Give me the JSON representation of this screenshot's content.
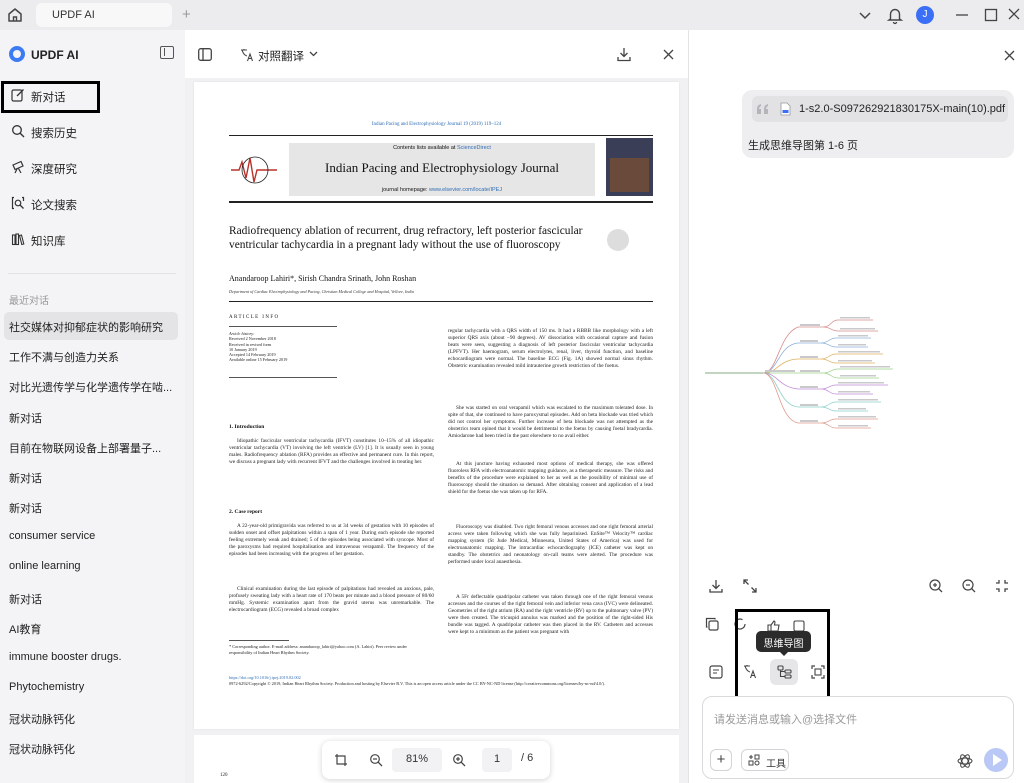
{
  "titlebar": {
    "tab_label": "UPDF AI",
    "avatar_letter": "J",
    "accent": "#3b6ff5"
  },
  "sidebar": {
    "brand": "UPDF AI",
    "nav": [
      {
        "label": "新对话",
        "icon": "edit-icon"
      },
      {
        "label": "搜索历史",
        "icon": "search-icon"
      },
      {
        "label": "深度研究",
        "icon": "research-icon"
      },
      {
        "label": "论文搜索",
        "icon": "paper-search-icon"
      },
      {
        "label": "知识库",
        "icon": "library-icon"
      }
    ],
    "recent_label": "最近对话",
    "recent": [
      "社交媒体对抑郁症状的影响研究",
      "工作不满与创造力关系",
      "对比光遗传学与化学遗传学在啮...",
      "新对话",
      "目前在物联网设备上部署量子...",
      "新对话",
      "新对话",
      "consumer service",
      "online learning",
      "新对话",
      "AI教育",
      "immune booster drugs.",
      "Phytochemistry",
      "冠状动脉钙化",
      "冠状动脉钙化"
    ]
  },
  "doc": {
    "translate_label": "对照翻译",
    "zoom": "81%",
    "current_page": "1",
    "total_pages": "/ 6",
    "next_page_number": "120",
    "paper": {
      "journal_line": "Indian Pacing and Electrophysiology Journal 19 (2019) 119–124",
      "contents_prefix": "Contents lists available at ",
      "contents_link": "ScienceDirect",
      "journal_title": "Indian Pacing and Electrophysiology Journal",
      "homepage_prefix": "journal homepage: ",
      "homepage_link": "www.elsevier.com/locate/IPEJ",
      "title": "Radiofrequency ablation of recurrent, drug refractory, left posterior fascicular ventricular tachycardia in a pregnant lady without the use of fluoroscopy",
      "authors": "Anandaroop Lahiri*, Sirish Chandra Srinath, John Roshan",
      "affiliation": "Department of Cardiac Electrophysiology and Pacing, Christian Medical College and Hospital, Vellore, India",
      "article_info": "ARTICLE INFO",
      "history": [
        "Article history:",
        "Received 2 November 2018",
        "Received in revised form",
        "10 January 2019",
        "Accepted 14 February 2019",
        "Available online 15 February 2019"
      ],
      "sec1": "1. Introduction",
      "sec1_body": "Idiopathic fascicular ventricular tachycardia (IFVT) constitutes 10–15% of all idiopathic ventricular tachycardia (VT) involving the left ventricle (LV) [1]. It is usually seen in young males. Radiofrequency ablation (RFA) provides an effective and permanent cure. In this report, we discuss a pregnant lady with recurrent IFVT and the challenges involved in treating her.",
      "sec2": "2. Case report",
      "sec2_body": "A 22-year-old primigravida was referred to us at 34 weeks of gestation with 10 episodes of sudden onset and offset palpitations within a span of 1 year. During each episode she reported feeling extremely weak and drained; 5 of the episodes being associated with syncope. Most of the paroxysms had required hospitalisation and intravenous verapamil. The frequency of the episodes had been increasing with the progress of her gestation.",
      "sec2_body2": "Clinical examination during the last episode of palpitations had revealed an anxious, pale, profusely sweating lady with a heart rate of 170 beats per minute and a blood pressure of 80/60 mmHg. Systemic examination apart from the gravid uterus was unremarkable. The electrocardiogram (ECG) revealed a broad complex",
      "right_p1": "regular tachycardia with a QRS width of 150 ms. It had a RBBB like morphology with a left superior QRS axis (about −90 degrees). AV dissociation with occasional capture and fusion beats were seen, suggesting a diagnosis of left posterior fascicular ventricular tachycardia (LPFVT). Her haemogram, serum electrolytes, renal, liver, thyroid function, and baseline echocardiogram were normal. The baseline ECG (Fig. 1A) showed normal sinus rhythm. Obstetric examination revealed mild intrauterine growth restriction of the foetus.",
      "right_p2": "She was started on oral verapamil which was escalated to the maximum tolerated dose. In spite of that, she continued to have paroxysmal episodes. Add on beta blockade was tried which did not control her symptoms. Further increase of beta blockade was not attempted as the obstetrics team opined that it would be detrimental to the foetus by causing foetal bradycardia. Amiodarone had been tried in the past elsewhere to no avail either.",
      "right_p3": "At this juncture having exhausted most options of medical therapy, she was offered fluoroless RFA with electroanatomic mapping guidance, as a therapeutic measure. The risks and benefits of the procedure were explained to her as well as the possibility of minimal use of fluoroscopy should the situation so demand. After obtaining consent and application of a lead shield for the foetus she was taken up for RFA.",
      "right_p4": "Fluoroscopy was disabled. Two right femoral venous accesses and one right femoral arterial access were taken following which she was fully heparinised. EnSite™ Velocity™ cardiac mapping system (St Jude Medical, Minnesota, United States of America) was used for electroanatomic mapping. The intracardiac echocardiography (ICE) catheter was kept on standby. The obstetrics and neonatology on-call teams were alerted. The procedure was performed under local anaesthesia.",
      "right_p5": "A 5Fr deflectable quadripolar catheter was taken through one of the right femoral venous accesses and the courses of the right femoral vein and inferior vena cava (IVC) were delineated. Geometries of the right atrium (RA) and the right ventricle (RV) up to the pulmonary valve (PV) were then created. The tricuspid annulus was marked and the position of the right-sided His bundle was tagged. A quadripolar catheter was then placed in the RV. Catheters and accesses were kept to a minimum as the patient was pregnant with",
      "footnote": "* Corresponding author. E-mail address: anandaroop_lahiri@yahoo.com (A. Lahiri). Peer review under responsibility of Indian Heart Rhythm Society.",
      "doi": "https://doi.org/10.1016/j.ipej.2019.02.002",
      "copyright": "0972-6292/Copyright © 2019, Indian Heart Rhythm Society. Production and hosting by Elsevier B.V. This is an open access article under the CC BY-NC-ND license (http://creativecommons.org/licenses/by-nc-nd/4.0/)."
    }
  },
  "chat": {
    "file_name": "1-s2.0-S097262921830175X-main(10).pdf",
    "user_message": "生成思维导图第 1-6 页",
    "tooltip": "思维导图",
    "input_placeholder": "请发送消息或输入@选择文件",
    "tools_label": "工具"
  }
}
